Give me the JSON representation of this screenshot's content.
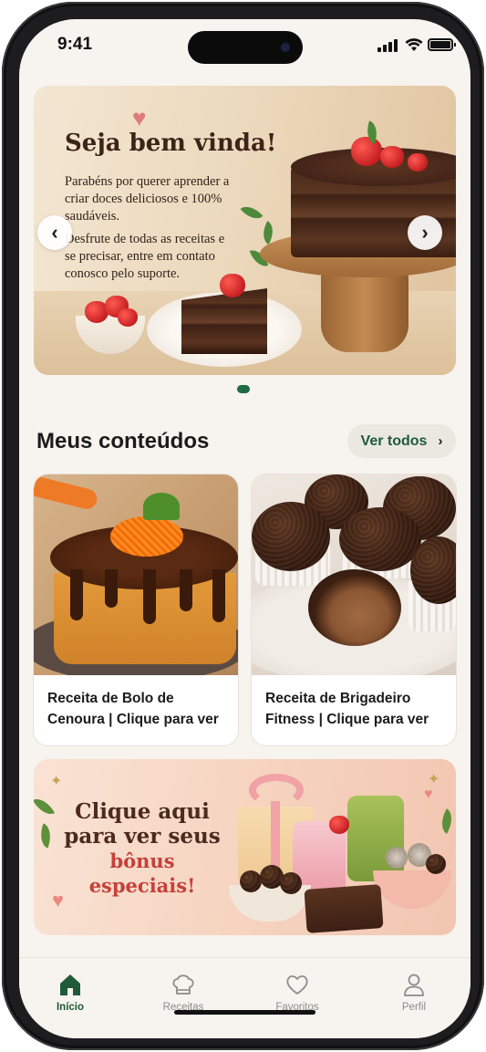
{
  "status_bar": {
    "time": "9:41"
  },
  "hero": {
    "title": "Seja bem vinda!",
    "paragraph_1": "Parabéns por querer aprender a criar doces deliciosos e 100% saudáveis.",
    "paragraph_2": "Desfrute de todas as receitas e se precisar, entre em contato conosco pelo suporte.",
    "prev_label": "‹",
    "next_label": "›",
    "slide_count": 1,
    "active_slide": 1
  },
  "section": {
    "title": "Meus conteúdos",
    "see_all_label": "Ver todos",
    "see_all_chevron": "›"
  },
  "cards": [
    {
      "title": "Receita de Bolo de Cenoura | Clique para ver"
    },
    {
      "title": "Receita de Brigadeiro Fitness | Clique para ver"
    }
  ],
  "bonus": {
    "line1": "Clique aqui",
    "line2": "para ver seus",
    "line3": "bônus especiais!"
  },
  "tabs": [
    {
      "label": "Início",
      "icon": "home-icon",
      "active": true
    },
    {
      "label": "Receitas",
      "icon": "chef-hat-icon",
      "active": false
    },
    {
      "label": "Favoritos",
      "icon": "heart-icon",
      "active": false
    },
    {
      "label": "Perfil",
      "icon": "user-icon",
      "active": false
    }
  ],
  "colors": {
    "accent": "#1f5b39",
    "background": "#f7f3ee",
    "bonus_highlight": "#c6403a"
  }
}
